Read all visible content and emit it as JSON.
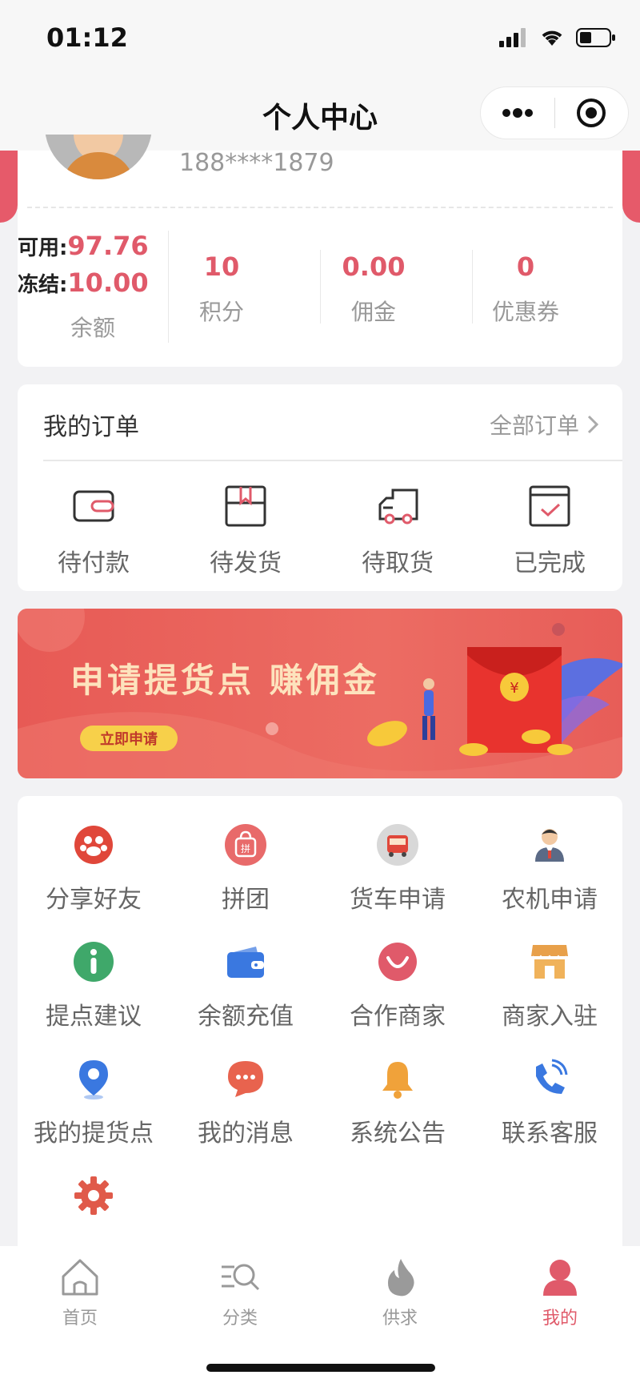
{
  "status_bar": {
    "time": "01:12"
  },
  "nav": {
    "title": "个人中心"
  },
  "profile": {
    "phone": "188****1879"
  },
  "balance": {
    "available_label": "可用:",
    "available_value": "97.76",
    "frozen_label": "冻结:",
    "frozen_value": "10.00",
    "caption": "余额"
  },
  "stats": [
    {
      "value": "10",
      "label": "积分"
    },
    {
      "value": "0.00",
      "label": "佣金"
    },
    {
      "value": "0",
      "label": "优惠券"
    }
  ],
  "orders": {
    "title": "我的订单",
    "all_label": "全部订单",
    "items": [
      {
        "label": "待付款",
        "icon": "wallet-icon"
      },
      {
        "label": "待发货",
        "icon": "box-icon"
      },
      {
        "label": "待取货",
        "icon": "truck-icon"
      },
      {
        "label": "已完成",
        "icon": "completed-icon"
      }
    ]
  },
  "banner": {
    "title": "申请提货点 赚佣金",
    "button": "立即申请"
  },
  "services": [
    {
      "label": "分享好友",
      "icon": "share-friends-icon",
      "color": "#e0473a"
    },
    {
      "label": "拼团",
      "icon": "group-buy-icon",
      "color": "#e86a6a"
    },
    {
      "label": "货车申请",
      "icon": "truck-apply-icon",
      "color": "#e0473a"
    },
    {
      "label": "农机申请",
      "icon": "farm-machine-icon",
      "color": "#5b6a86"
    },
    {
      "label": "提点建议",
      "icon": "info-icon",
      "color": "#3fa86a"
    },
    {
      "label": "余额充值",
      "icon": "wallet-recharge-icon",
      "color": "#3a78e0"
    },
    {
      "label": "合作商家",
      "icon": "partner-icon",
      "color": "#e05a6a"
    },
    {
      "label": "商家入驻",
      "icon": "store-icon",
      "color": "#e8a04a"
    },
    {
      "label": "我的提货点",
      "icon": "location-pin-icon",
      "color": "#3a78e0"
    },
    {
      "label": "我的消息",
      "icon": "message-icon",
      "color": "#e8634e"
    },
    {
      "label": "系统公告",
      "icon": "bell-icon",
      "color": "#f0a23a"
    },
    {
      "label": "联系客服",
      "icon": "phone-icon",
      "color": "#3a78e0"
    },
    {
      "label": "",
      "icon": "settings-icon",
      "color": "#e05a4a"
    }
  ],
  "tabs": [
    {
      "label": "首页",
      "icon": "home-icon"
    },
    {
      "label": "分类",
      "icon": "category-search-icon"
    },
    {
      "label": "供求",
      "icon": "flame-icon"
    },
    {
      "label": "我的",
      "icon": "user-icon",
      "active": true
    }
  ],
  "colors": {
    "accent": "#e05a6a",
    "banner": "#e75a55"
  }
}
